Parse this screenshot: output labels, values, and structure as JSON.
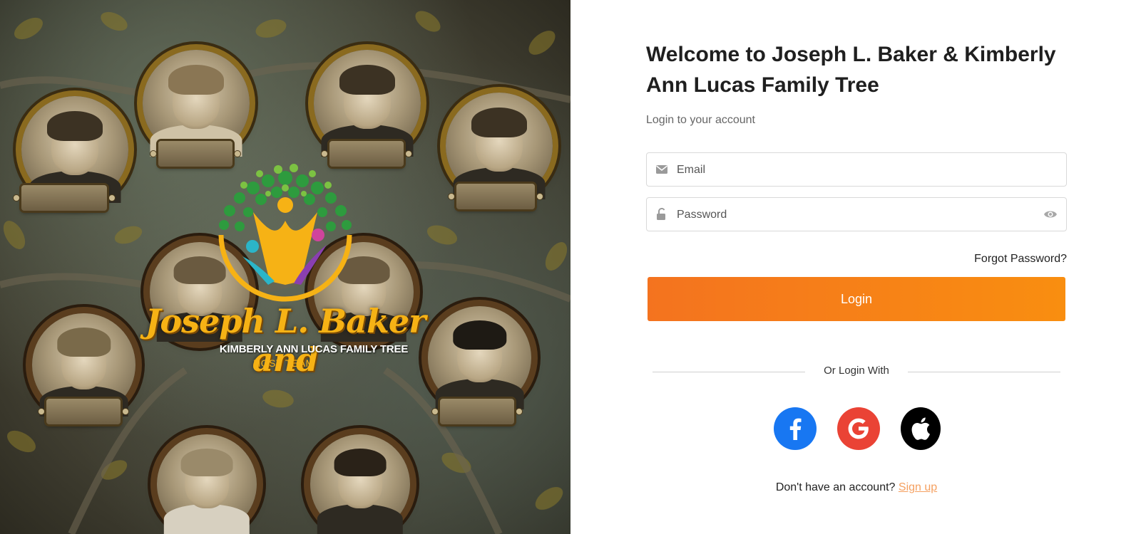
{
  "hero": {
    "logo_script": "Joseph L. Baker and",
    "logo_line2": "KIMBERLY ANN LUCAS FAMILY TREE",
    "logo_line3": "HOST TEAM",
    "colors": {
      "gold": "#f6b215",
      "green": "#2e9b3e",
      "teal": "#2bb5c8",
      "purple": "#8a3fb0",
      "pink": "#d0449c"
    }
  },
  "login": {
    "title": "Welcome to Joseph L. Baker & Kimberly Ann Lucas Family Tree",
    "subtitle": "Login to your account",
    "email_placeholder": "Email",
    "password_placeholder": "Password",
    "forgot_label": "Forgot Password?",
    "login_label": "Login",
    "divider_label": "Or Login With",
    "signup_prompt": "Don't have an account? ",
    "signup_link": "Sign up",
    "social": [
      {
        "name": "facebook",
        "icon": "facebook-icon",
        "color": "#1877f2"
      },
      {
        "name": "google",
        "icon": "google-icon",
        "color": "#ea4335"
      },
      {
        "name": "apple",
        "icon": "apple-icon",
        "color": "#000000"
      }
    ],
    "colors": {
      "accent_start": "#f4731f",
      "accent_end": "#f98e10",
      "link": "#f5a060"
    }
  }
}
